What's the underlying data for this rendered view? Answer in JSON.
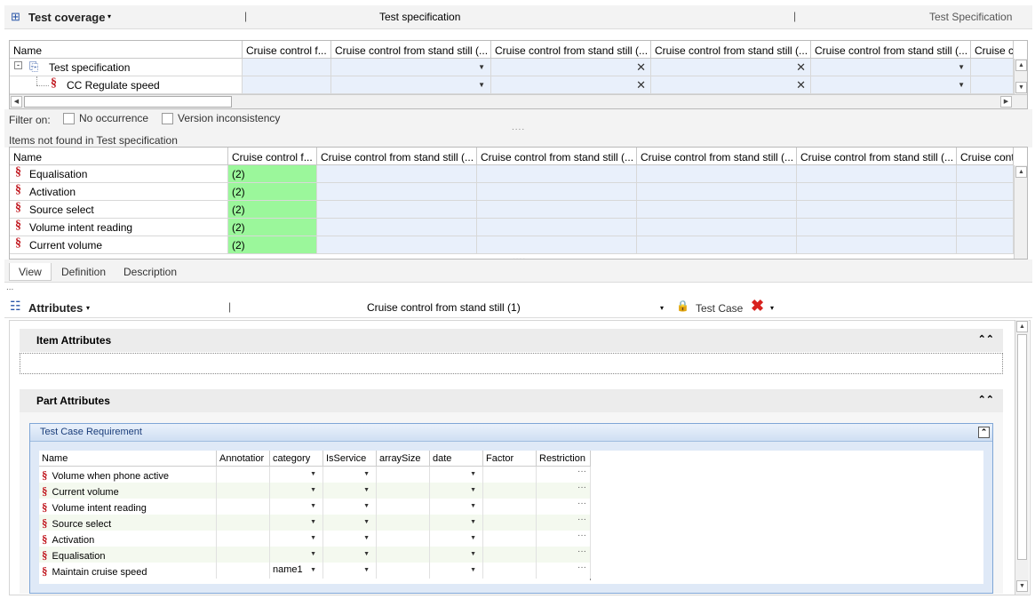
{
  "coverage": {
    "title": "Test coverage",
    "center": "Test specification",
    "right": "Test Specification"
  },
  "grid1": {
    "name_header": "Name",
    "col_headers": [
      "Cruise control f...",
      "Cruise control from stand still (...",
      "Cruise control from stand still (...",
      "Cruise control from stand still (...",
      "Cruise control from stand still (...",
      "Cruise c"
    ],
    "rows": [
      "Test specification",
      "CC Regulate speed"
    ]
  },
  "filter": {
    "label": "Filter on:",
    "no_occurrence": "No occurrence",
    "version_inconsistency": "Version inconsistency"
  },
  "not_found_label": "Items not found in Test specification",
  "grid2": {
    "name_header": "Name",
    "col_headers": [
      "Cruise control f...",
      "Cruise control from stand still (...",
      "Cruise control from stand still (...",
      "Cruise control from stand still (...",
      "Cruise control from stand still (...",
      "Cruise cont"
    ],
    "rows": [
      {
        "name": "Equalisation",
        "value": "(2)"
      },
      {
        "name": "Activation",
        "value": "(2)"
      },
      {
        "name": "Source select",
        "value": "(2)"
      },
      {
        "name": "Volume intent reading",
        "value": "(2)"
      },
      {
        "name": "Current volume",
        "value": "(2)"
      }
    ]
  },
  "tabs": [
    "View",
    "Definition",
    "Description"
  ],
  "attributes": {
    "title": "Attributes",
    "selected": "Cruise control from stand still (1)",
    "test_case": "Test Case"
  },
  "item_attributes": "Item Attributes",
  "part_attributes": "Part Attributes",
  "tcr": {
    "title": "Test Case Requirement",
    "headers": [
      "Name",
      "Annotatior",
      "category",
      "IsService",
      "arraySize",
      "date",
      "Factor",
      "Restriction"
    ],
    "rows": [
      {
        "name": "Volume when phone active",
        "category": ""
      },
      {
        "name": "Current volume",
        "category": ""
      },
      {
        "name": "Volume intent reading",
        "category": ""
      },
      {
        "name": "Source select",
        "category": ""
      },
      {
        "name": "Activation",
        "category": ""
      },
      {
        "name": "Equalisation",
        "category": ""
      },
      {
        "name": "Maintain cruise speed",
        "category": "name1"
      }
    ]
  }
}
